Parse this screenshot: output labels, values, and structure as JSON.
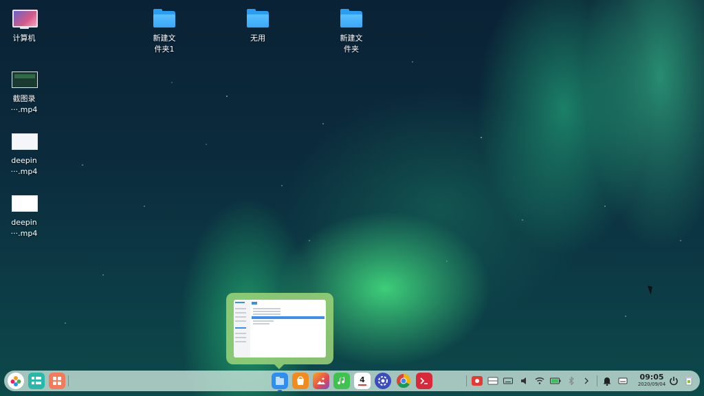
{
  "desktop": {
    "icons": [
      {
        "label_line1": "计算机",
        "label_line2": ""
      },
      {
        "label_line1": "截图录",
        "label_line2": "···.mp4"
      },
      {
        "label_line1": "deepin",
        "label_line2": "···.mp4"
      },
      {
        "label_line1": "deepin",
        "label_line2": "···.mp4"
      },
      {
        "label_line1": "新建文",
        "label_line2": "件夹1"
      },
      {
        "label_line1": "无用",
        "label_line2": ""
      },
      {
        "label_line1": "新建文",
        "label_line2": "件夹"
      }
    ]
  },
  "dock": {
    "apps": [
      {
        "icon": "launcher-icon"
      },
      {
        "icon": "multitask-view-icon"
      },
      {
        "icon": "show-desktop-icon"
      },
      {
        "icon": "file-manager-icon",
        "running": true
      },
      {
        "icon": "app-store-icon"
      },
      {
        "icon": "image-viewer-icon"
      },
      {
        "icon": "music-icon"
      },
      {
        "icon": "calendar-icon",
        "calendar_day": "4"
      },
      {
        "icon": "control-center-icon"
      },
      {
        "icon": "chrome-icon"
      },
      {
        "icon": "terminal-icon"
      }
    ],
    "tray": [
      {
        "icon": "screen-recorder-icon"
      },
      {
        "icon": "screenshot-icon"
      },
      {
        "icon": "keyboard-icon"
      },
      {
        "icon": "volume-icon"
      },
      {
        "icon": "wifi-icon"
      },
      {
        "icon": "battery-icon"
      },
      {
        "icon": "bluetooth-icon"
      },
      {
        "icon": "expand-tray-icon"
      },
      {
        "icon": "notification-bell-icon"
      },
      {
        "icon": "notification-center-icon"
      }
    ],
    "clock": {
      "time": "09:05",
      "date": "2020/09/04"
    },
    "power": {
      "icon": "power-icon"
    },
    "trash": {
      "icon": "trash-icon"
    }
  },
  "colors": {
    "folder": "#2a9df4",
    "dock_bg": "#cee8de",
    "preview_bg": "#9ed678",
    "accent": "#3b8df0"
  }
}
